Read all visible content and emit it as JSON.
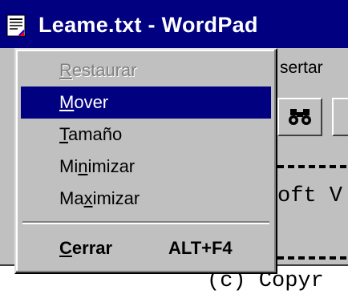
{
  "window": {
    "title": "Leame.txt - WordPad",
    "icon": "wordpad-document-icon"
  },
  "menubar": {
    "visible_item": "sertar"
  },
  "toolbar": {
    "find_button_icon": "binoculars-icon"
  },
  "document": {
    "line1": "oft V",
    "line2": "(c) Copyr"
  },
  "system_menu": {
    "items": [
      {
        "pre": "",
        "acc": "R",
        "post": "estaurar",
        "enabled": false,
        "selected": false
      },
      {
        "pre": "",
        "acc": "M",
        "post": "over",
        "enabled": true,
        "selected": true
      },
      {
        "pre": "",
        "acc": "T",
        "post": "amaño",
        "enabled": true,
        "selected": false
      },
      {
        "pre": "Mi",
        "acc": "n",
        "post": "imizar",
        "enabled": true,
        "selected": false
      },
      {
        "pre": "Ma",
        "acc": "x",
        "post": "imizar",
        "enabled": true,
        "selected": false
      }
    ],
    "close": {
      "pre": "",
      "acc": "C",
      "post": "errar",
      "shortcut": "ALT+F4"
    }
  },
  "colors": {
    "titlebar": "#000080",
    "selection": "#000080",
    "face": "#c0c0c0"
  }
}
